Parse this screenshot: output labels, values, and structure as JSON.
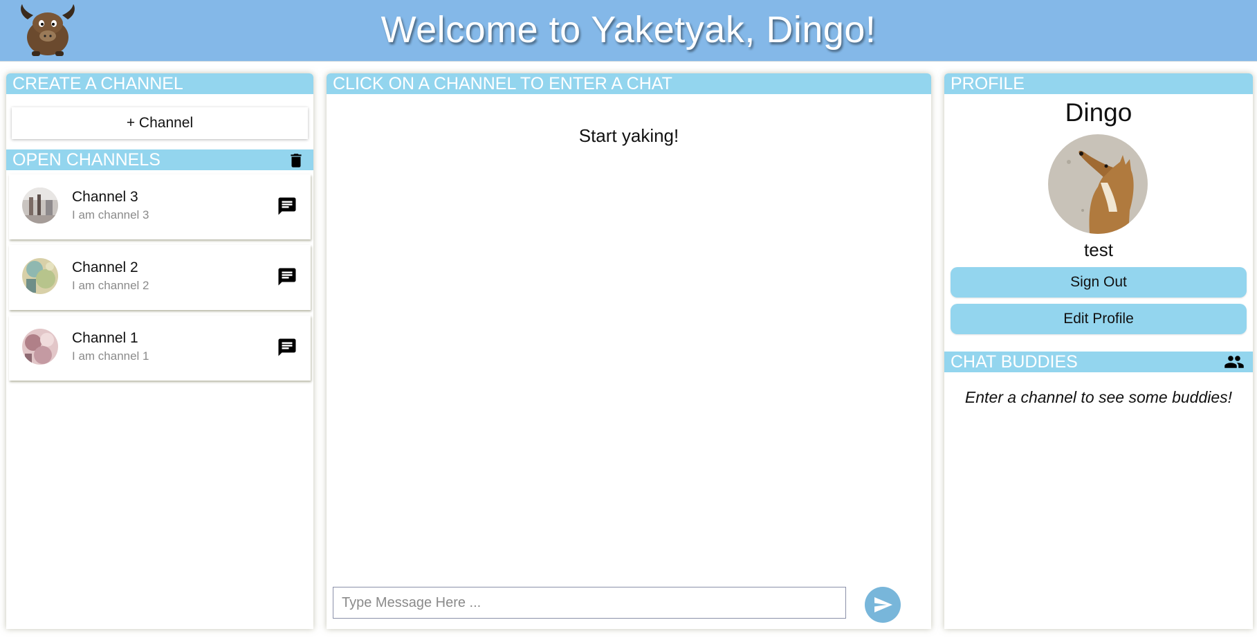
{
  "header": {
    "title": "Welcome to Yaketyak, Dingo!",
    "logo_icon": "yak-logo-icon"
  },
  "colors": {
    "header_bg": "#84b8e8",
    "bar_bg": "#93d5ee",
    "send_bg": "#78b6da"
  },
  "left": {
    "create_title": "CREATE A CHANNEL",
    "add_channel_label": "+ Channel",
    "open_title": "OPEN CHANNELS",
    "delete_icon": "trash-icon",
    "channels": [
      {
        "name": "Channel 3",
        "description": "I am channel 3",
        "icon": "chat-icon"
      },
      {
        "name": "Channel 2",
        "description": "I am channel 2",
        "icon": "chat-icon"
      },
      {
        "name": "Channel 1",
        "description": "I am channel 1",
        "icon": "chat-icon"
      }
    ]
  },
  "middle": {
    "title": "CLICK ON A CHANNEL TO ENTER A CHAT",
    "start_text": "Start yaking!",
    "input_placeholder": "Type Message Here ...",
    "send_icon": "send-icon"
  },
  "right": {
    "profile_title": "PROFILE",
    "username": "Dingo",
    "status": "test",
    "sign_out_label": "Sign Out",
    "edit_profile_label": "Edit Profile",
    "buddies_title": "CHAT BUDDIES",
    "buddies_icon": "people-icon",
    "buddies_empty": "Enter a channel to see some buddies!"
  }
}
